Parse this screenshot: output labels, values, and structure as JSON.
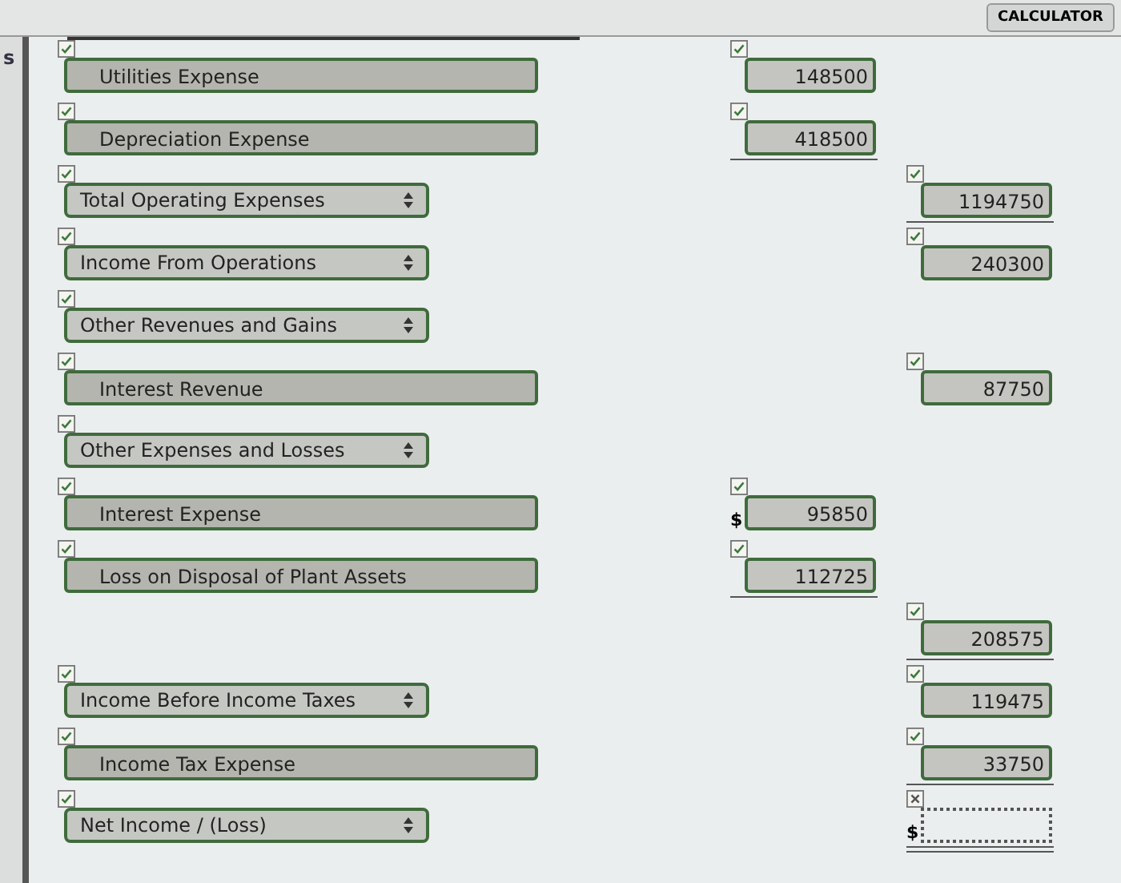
{
  "header": {
    "left_text": "s",
    "button": "CALCULATOR"
  },
  "rows": [
    {
      "label": {
        "kind": "text",
        "text": "Utilities Expense",
        "correct": true
      },
      "middle_amount": {
        "value": "148500",
        "correct": true,
        "underlined": false
      }
    },
    {
      "label": {
        "kind": "text",
        "text": "Depreciation Expense",
        "correct": true
      },
      "middle_amount": {
        "value": "418500",
        "correct": true,
        "underlined": true
      }
    },
    {
      "label": {
        "kind": "select",
        "text": "Total Operating Expenses",
        "correct": true
      },
      "right_amount": {
        "value": "1194750",
        "correct": true,
        "underlined": true
      }
    },
    {
      "label": {
        "kind": "select",
        "text": "Income From Operations",
        "correct": true
      },
      "right_amount": {
        "value": "240300",
        "correct": true,
        "underlined": false
      }
    },
    {
      "label": {
        "kind": "select",
        "text": "Other Revenues and Gains",
        "correct": true
      }
    },
    {
      "label": {
        "kind": "text",
        "text": "Interest Revenue",
        "correct": true
      },
      "right_amount": {
        "value": "87750",
        "correct": true,
        "underlined": false
      }
    },
    {
      "label": {
        "kind": "select",
        "text": "Other Expenses and Losses",
        "correct": true
      }
    },
    {
      "label": {
        "kind": "text",
        "text": "Interest Expense",
        "correct": true
      },
      "middle_amount": {
        "prefix": "$",
        "value": "95850",
        "correct": true,
        "underlined": false
      }
    },
    {
      "label": {
        "kind": "text",
        "text": "Loss on Disposal of Plant Assets",
        "correct": true
      },
      "middle_amount": {
        "value": "112725",
        "correct": true,
        "underlined": true
      }
    },
    {
      "right_amount": {
        "value": "208575",
        "correct": true,
        "underlined": true
      }
    },
    {
      "label": {
        "kind": "select",
        "text": "Income Before Income Taxes",
        "correct": true
      },
      "right_amount": {
        "value": "119475",
        "correct": true,
        "underlined": false
      }
    },
    {
      "label": {
        "kind": "text",
        "text": "Income Tax Expense",
        "correct": true
      },
      "right_amount": {
        "value": "33750",
        "correct": true,
        "underlined": true
      }
    },
    {
      "label": {
        "kind": "select",
        "text": "Net Income / (Loss)",
        "correct": true
      },
      "right_amount": {
        "prefix": "$",
        "correct": false,
        "underlined": true,
        "double_underlined": true
      }
    }
  ]
}
